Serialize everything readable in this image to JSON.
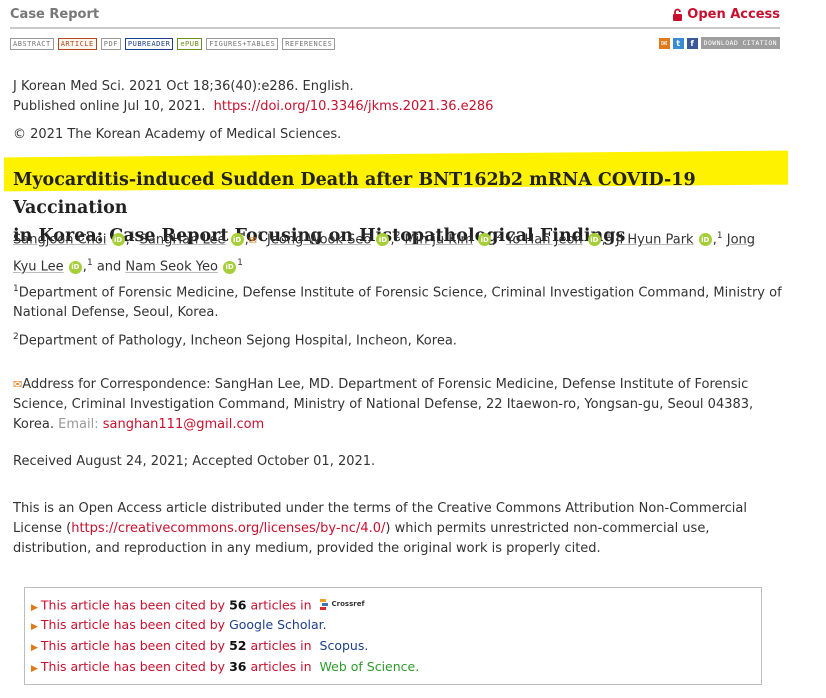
{
  "header": {
    "article_type": "Case Report",
    "open_access": "Open Access",
    "tabs": [
      "ABSTRACT",
      "ARTICLE",
      "PDF",
      "PUBREADER",
      "ePUB",
      "FIGURES+TABLES",
      "REFERENCES"
    ],
    "download_citation": "DOWNLOAD CITATION",
    "colors": {
      "accent": "#c8102e",
      "highlight": "#fff200"
    }
  },
  "meta": {
    "journal": "J Korean Med Sci. 2021 Oct 18;36(40):e286. English.",
    "published": "Published online Jul 10, 2021.",
    "doi": "https://doi.org/10.3346/jkms.2021.36.e286",
    "copyright": "© 2021 The Korean Academy of Medical Sciences."
  },
  "title": {
    "line1": "Myocarditis-induced Sudden Death after BNT162b2 mRNA COVID-19 Vaccination",
    "line2": "in Korea: Case Report Focusing on Histopathological Findings"
  },
  "authors": [
    {
      "name": "Sangjoon Choi",
      "aff": "1"
    },
    {
      "name": "SangHan Lee",
      "aff": "1"
    },
    {
      "name": "Jeong-Wook Seo",
      "aff": "2"
    },
    {
      "name": "Min-ju Kim",
      "aff": "2"
    },
    {
      "name": "Yo Han Jeon",
      "aff": "1"
    },
    {
      "name": "Ji Hyun Park",
      "aff": "1"
    },
    {
      "name": "Jong Kyu Lee",
      "aff": "1"
    },
    {
      "name": "Nam Seok Yeo",
      "aff": "1"
    }
  ],
  "authors_and": "and",
  "affiliations": [
    {
      "num": "1",
      "text": "Department of Forensic Medicine, Defense Institute of Forensic Science, Criminal Investigation Command, Ministry of National Defense, Seoul, Korea."
    },
    {
      "num": "2",
      "text": "Department of Pathology, Incheon Sejong Hospital, Incheon, Korea."
    }
  ],
  "correspondence": {
    "text": "Address for Correspondence: SangHan Lee, MD. Department of Forensic Medicine, Defense Institute of Forensic Science, Criminal Investigation Command, Ministry of National Defense, 22 Itaewon-ro, Yongsan-gu, Seoul 04383, Korea.",
    "email_label": "Email:",
    "email": "sanghan111@gmail.com"
  },
  "received": "Received August 24, 2021; Accepted October 01, 2021.",
  "license": {
    "before": "This is an Open Access article distributed under the terms of the Creative Commons Attribution Non-Commercial License (",
    "url": "https://creativecommons.org/licenses/by-nc/4.0/",
    "after": ") which permits unrestricted non-commercial use, distribution, and reproduction in any medium, provided the original work is properly cited."
  },
  "citations": [
    {
      "prefix": "This article has been cited by",
      "count": "56",
      "mid": "articles in",
      "source": "Crossref"
    },
    {
      "prefix": "This article has been cited by",
      "count": "",
      "mid": "",
      "source": "Google Scholar."
    },
    {
      "prefix": "This article has been cited by",
      "count": "52",
      "mid": "articles in",
      "source": "Scopus."
    },
    {
      "prefix": "This article has been cited by",
      "count": "36",
      "mid": "articles in",
      "source": "Web of Science."
    }
  ]
}
